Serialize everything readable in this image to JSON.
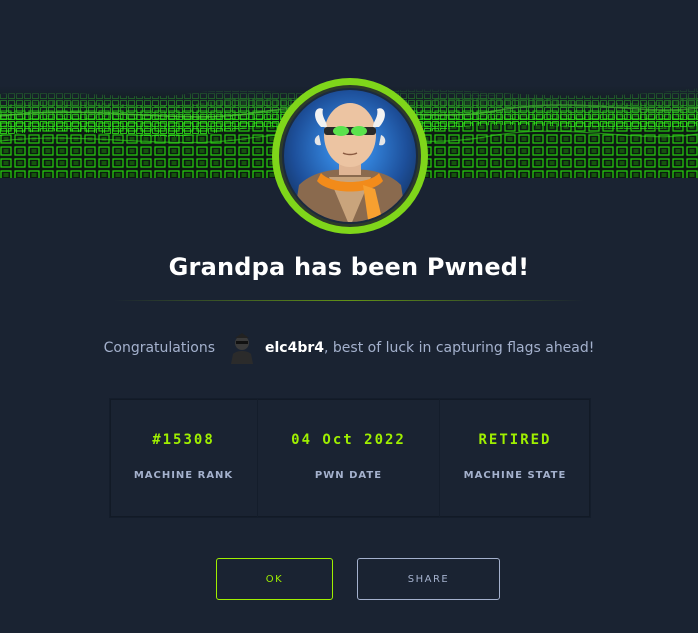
{
  "dialog": {
    "title": "Grandpa has been Pwned!",
    "congrats_prefix": "Congratulations",
    "username": "elc4br4",
    "congrats_suffix": ", best of luck in capturing flags ahead!"
  },
  "stats": [
    {
      "value": "#15308",
      "label": "MACHINE RANK"
    },
    {
      "value": "04 Oct 2022",
      "label": "PWN DATE"
    },
    {
      "value": "RETIRED",
      "label": "MACHINE STATE"
    }
  ],
  "buttons": {
    "ok_label": "OK",
    "share_label": "SHARE"
  },
  "colors": {
    "background": "#1a2332",
    "accent_green": "#9fef00",
    "muted_text": "#a4b1cd"
  }
}
